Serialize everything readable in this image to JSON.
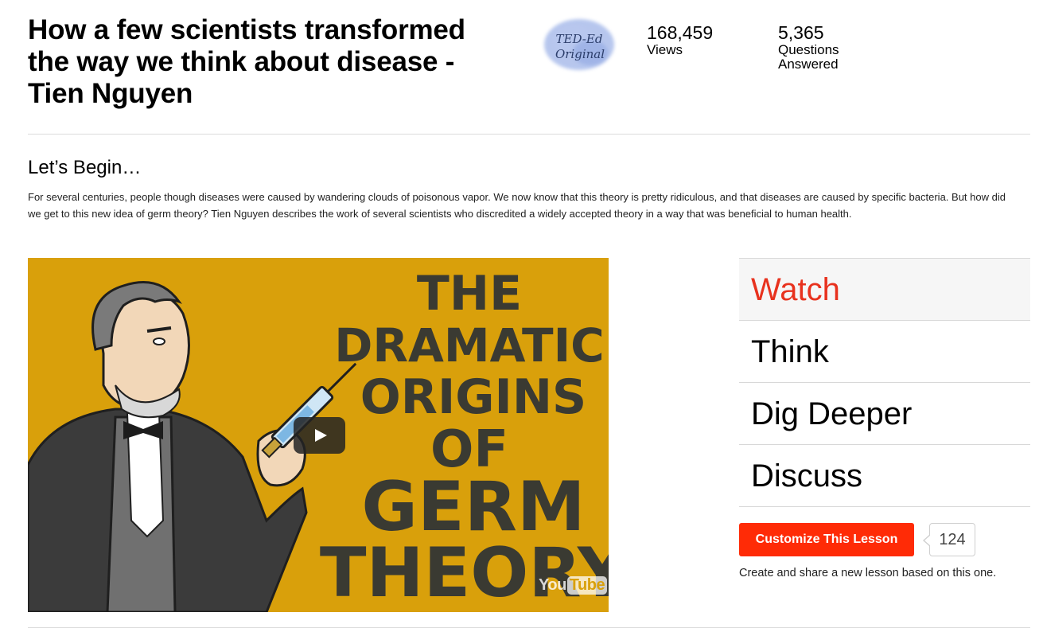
{
  "lesson": {
    "title": "How a few scientists transformed the way we think about disease - Tien Nguyen",
    "badge": {
      "line1": "TED-Ed",
      "line2": "Original",
      "icon": "ted-ed-original-badge"
    },
    "stats": {
      "views_value": "168,459",
      "views_label": "Views",
      "questions_value": "5,365",
      "questions_label_line1": "Questions",
      "questions_label_line2": "Answered"
    }
  },
  "intro": {
    "heading": "Let’s Begin…",
    "description": "For several centuries, people though diseases were caused by wandering clouds of poisonous vapor. We now know that this theory is pretty ridiculous, and that diseases are caused by specific bacteria. But how did we get to this new idea of germ theory? Tien Nguyen describes the work of several scientists who discredited a widely accepted theory in a way that was beneficial to human health."
  },
  "video": {
    "title_lines": [
      "THE",
      "DRAMATIC",
      "ORIGINS",
      "OF",
      "GERM",
      "THEORY"
    ],
    "play_icon": "play-icon",
    "provider_you": "You",
    "provider_tube": "Tube",
    "colors": {
      "background": "#d9a00b",
      "lettering": "#3a3a32"
    }
  },
  "nav": {
    "tabs": [
      {
        "label": "Watch",
        "active": true
      },
      {
        "label": "Think",
        "active": false
      },
      {
        "label": "Dig Deeper",
        "active": false
      },
      {
        "label": "Discuss",
        "active": false
      }
    ]
  },
  "customize": {
    "button_label": "Customize This Lesson",
    "count": "124",
    "note": "Create and share a new lesson based on this one."
  },
  "colors": {
    "accent": "#e8321e",
    "button": "#ff2b06"
  }
}
